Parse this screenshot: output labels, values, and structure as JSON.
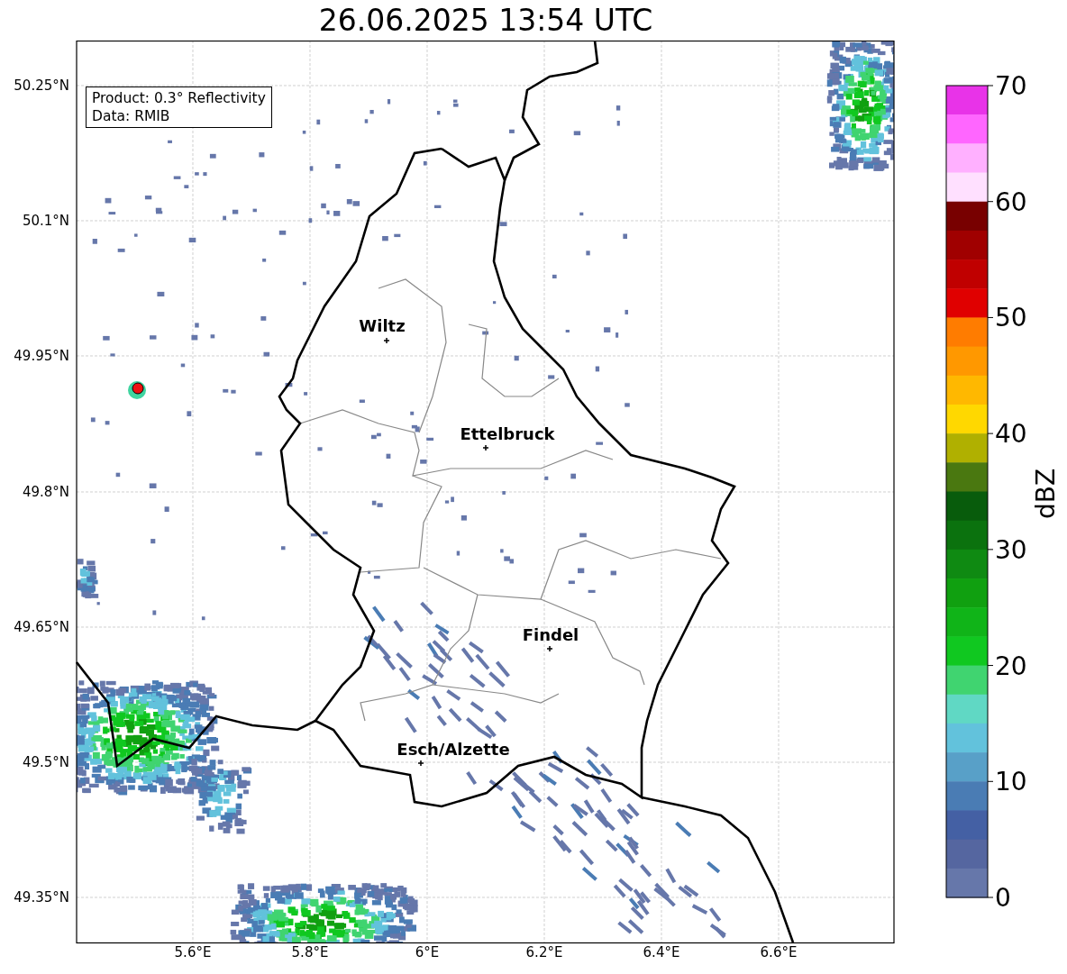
{
  "title": "26.06.2025 13:54 UTC",
  "map": {
    "info_box": [
      "Product: 0.3° Reflectivity",
      "Data: RMIB"
    ],
    "xticks": [
      "5.6°E",
      "5.8°E",
      "6°E",
      "6.2°E",
      "6.4°E",
      "6.6°E"
    ],
    "yticks": [
      "50.25°N",
      "50.1°N",
      "49.95°N",
      "49.8°N",
      "49.65°N",
      "49.5°N",
      "49.35°N"
    ],
    "cities": [
      {
        "name": "Wiltz"
      },
      {
        "name": "Ettelbruck"
      },
      {
        "name": "Findel"
      },
      {
        "name": "Esch/Alzette"
      }
    ]
  },
  "colorbar": {
    "label": "dBZ",
    "ticks": [
      "70",
      "60",
      "50",
      "40",
      "30",
      "20",
      "10",
      "0"
    ],
    "segments": [
      {
        "color": "#e833e8"
      },
      {
        "color": "#ff66ff"
      },
      {
        "color": "#ffb0ff"
      },
      {
        "color": "#ffe0ff"
      },
      {
        "color": "#780000"
      },
      {
        "color": "#a00000"
      },
      {
        "color": "#c00000"
      },
      {
        "color": "#e00000"
      },
      {
        "color": "#ff7c00"
      },
      {
        "color": "#ff9800"
      },
      {
        "color": "#ffb800"
      },
      {
        "color": "#ffd800"
      },
      {
        "color": "#b0b000"
      },
      {
        "color": "#4a7810"
      },
      {
        "color": "#085c0c"
      },
      {
        "color": "#0b720e"
      },
      {
        "color": "#0f8a12"
      },
      {
        "color": "#10a010"
      },
      {
        "color": "#10b418"
      },
      {
        "color": "#10c820"
      },
      {
        "color": "#40d470"
      },
      {
        "color": "#60d8c4"
      },
      {
        "color": "#62c2dc"
      },
      {
        "color": "#58a0c8"
      },
      {
        "color": "#4a7cb4"
      },
      {
        "color": "#4460a4"
      },
      {
        "color": "#5566a0"
      },
      {
        "color": "#6677aa"
      }
    ]
  }
}
